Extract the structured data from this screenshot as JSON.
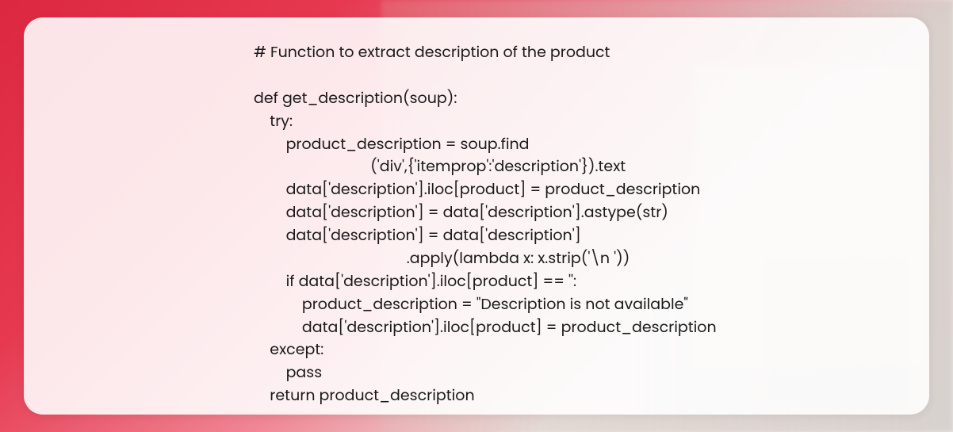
{
  "code": {
    "comment": "# Function to extract description of the product",
    "blank1": "",
    "def_line": "def get_description(soup):",
    "try_line": "    try:",
    "line1": "        product_description = soup.find",
    "line2": "                             ('div',{'itemprop':'description'}).text",
    "line3": "        data['description'].iloc[product] = product_description",
    "line4": "        data['description'] = data['description'].astype(str)",
    "line5": "        data['description'] = data['description']",
    "line6": "                                      .apply(lambda x: x.strip('\\n '))",
    "line7": "        if data['description'].iloc[product] == '':",
    "line8": "            product_description = \"Description is not available\"",
    "line9": "            data['description'].iloc[product] = product_description",
    "except_line": "    except:",
    "pass_line": "        pass",
    "return_line": "    return product_description"
  }
}
